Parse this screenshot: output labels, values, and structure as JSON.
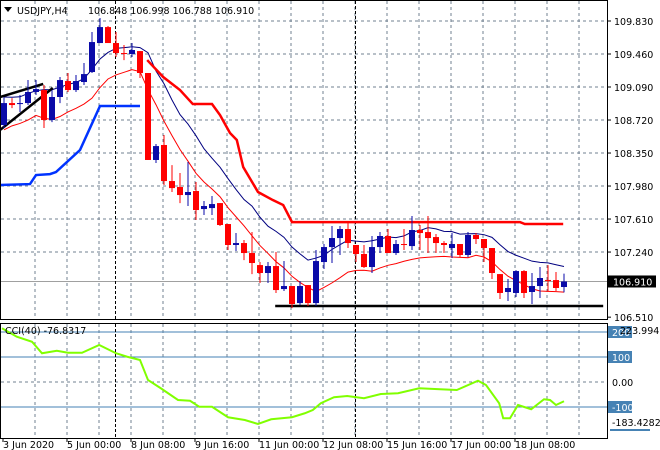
{
  "header": {
    "symbol": "USDJPY,H4",
    "ohlc": "106.848 106.998 106.788 106.910",
    "menu_icon": "triangle-down-icon"
  },
  "colors": {
    "bull": "#0a0aa8",
    "bear": "#ff0000",
    "ma_fast": "#ff0000",
    "ma_slow": "#000080",
    "trail_red": "#ff0000",
    "trail_blue": "#0033ff",
    "cci": "#80ff00",
    "grid": "#708090",
    "level": "#4682b4"
  },
  "chart_data": [
    {
      "type": "candlestick",
      "title": "USDJPY,H4",
      "ylim": [
        106.45,
        110.05
      ],
      "y_ticks": [
        "109.830",
        "109.460",
        "109.090",
        "108.720",
        "108.350",
        "107.980",
        "107.610",
        "107.240",
        "106.510"
      ],
      "current_price": "106.910",
      "x_tick_labels": [
        "3 Jun 2020",
        "5 Jun 00:00",
        "8 Jun 08:00",
        "9 Jun 16:00",
        "11 Jun 00:00",
        "12 Jun 08:00",
        "15 Jun 16:00",
        "17 Jun 00:00",
        "18 Jun 08:00"
      ],
      "x_tick_index": [
        0,
        8,
        16,
        24,
        32,
        40,
        48,
        56,
        64
      ],
      "candles_ohlc": [
        [
          108.664,
          108.978,
          108.63,
          108.91
        ],
        [
          108.91,
          108.966,
          108.854,
          108.888
        ],
        [
          108.899,
          109.0,
          108.81,
          108.91
        ],
        [
          108.91,
          109.168,
          108.888,
          109.034
        ],
        [
          109.034,
          109.168,
          109.0,
          109.067
        ],
        [
          109.056,
          109.112,
          108.63,
          108.72
        ],
        [
          108.72,
          109.056,
          108.697,
          108.978
        ],
        [
          108.978,
          109.202,
          108.91,
          109.168
        ],
        [
          109.157,
          109.247,
          109.034,
          109.056
        ],
        [
          109.056,
          109.224,
          109.034,
          109.157
        ],
        [
          109.146,
          109.359,
          109.112,
          109.235
        ],
        [
          109.258,
          109.706,
          109.247,
          109.594
        ],
        [
          109.583,
          109.863,
          109.583,
          109.762
        ],
        [
          109.762,
          109.774,
          109.583,
          109.583
        ],
        [
          109.583,
          109.706,
          109.426,
          109.471
        ],
        [
          109.471,
          109.561,
          109.392,
          109.46
        ],
        [
          109.46,
          109.583,
          109.426,
          109.505
        ],
        [
          109.493,
          109.493,
          109.191,
          109.247
        ],
        [
          109.247,
          109.247,
          108.272,
          108.272
        ],
        [
          108.272,
          108.451,
          108.238,
          108.428
        ],
        [
          108.44,
          108.552,
          107.991,
          108.036
        ],
        [
          108.036,
          108.215,
          107.913,
          107.957
        ],
        [
          107.969,
          108.126,
          107.789,
          107.879
        ],
        [
          107.879,
          108.249,
          107.756,
          107.913
        ],
        [
          107.924,
          108.025,
          107.599,
          107.711
        ],
        [
          107.722,
          107.812,
          107.655,
          107.756
        ],
        [
          107.733,
          107.868,
          107.655,
          107.778
        ],
        [
          107.789,
          107.789,
          107.532,
          107.543
        ],
        [
          107.554,
          107.554,
          107.263,
          107.319
        ],
        [
          107.319,
          107.453,
          107.251,
          107.341
        ],
        [
          107.341,
          107.375,
          107.15,
          107.229
        ],
        [
          107.229,
          107.464,
          106.993,
          107.117
        ],
        [
          107.094,
          107.128,
          106.893,
          107.005
        ],
        [
          107.005,
          107.128,
          106.893,
          107.083
        ],
        [
          107.083,
          107.24,
          106.781,
          106.814
        ],
        [
          106.825,
          107.139,
          106.803,
          106.859
        ],
        [
          106.859,
          106.859,
          106.612,
          106.657
        ],
        [
          106.668,
          106.915,
          106.646,
          106.859
        ],
        [
          106.87,
          106.87,
          106.635,
          106.668
        ],
        [
          106.668,
          107.263,
          106.635,
          107.139
        ],
        [
          107.128,
          107.33,
          107.05,
          107.296
        ],
        [
          107.296,
          107.532,
          107.117,
          107.397
        ],
        [
          107.397,
          107.532,
          107.207,
          107.498
        ],
        [
          107.498,
          107.576,
          107.285,
          107.341
        ],
        [
          107.319,
          107.319,
          107.128,
          107.218
        ],
        [
          107.218,
          107.319,
          107.061,
          107.072
        ],
        [
          107.072,
          107.42,
          107.005,
          107.296
        ],
        [
          107.296,
          107.464,
          107.229,
          107.42
        ],
        [
          107.42,
          107.498,
          107.229,
          107.229
        ],
        [
          107.229,
          107.375,
          107.207,
          107.33
        ],
        [
          107.33,
          107.498,
          107.263,
          107.319
        ],
        [
          107.307,
          107.644,
          107.263,
          107.487
        ],
        [
          107.487,
          107.543,
          107.263,
          107.453
        ],
        [
          107.464,
          107.644,
          107.229,
          107.397
        ],
        [
          107.408,
          107.442,
          107.229,
          107.341
        ],
        [
          107.341,
          107.363,
          107.229,
          107.319
        ],
        [
          107.285,
          107.453,
          107.173,
          107.33
        ],
        [
          107.33,
          107.33,
          107.184,
          107.207
        ],
        [
          107.207,
          107.464,
          107.184,
          107.431
        ],
        [
          107.431,
          107.453,
          107.33,
          107.386
        ],
        [
          107.386,
          107.386,
          107.128,
          107.285
        ],
        [
          107.285,
          107.285,
          106.938,
          107.005
        ],
        [
          106.993,
          106.993,
          106.714,
          106.781
        ],
        [
          106.792,
          106.938,
          106.691,
          106.837
        ],
        [
          106.781,
          107.038,
          106.736,
          107.027
        ],
        [
          107.027,
          107.038,
          106.725,
          106.781
        ],
        [
          106.792,
          107.005,
          106.657,
          106.859
        ],
        [
          106.859,
          107.072,
          106.725,
          106.949
        ],
        [
          106.927,
          107.094,
          106.803,
          106.915
        ],
        [
          106.926,
          107.016,
          106.803,
          106.837
        ],
        [
          106.848,
          106.998,
          106.788,
          106.91
        ]
      ],
      "trail_red": [
        [
          17.9,
          109.392
        ],
        [
          19.9,
          109.202
        ],
        [
          22.0,
          109.056
        ],
        [
          23.6,
          108.899
        ],
        [
          26.0,
          108.899
        ],
        [
          27.0,
          108.776
        ],
        [
          28.25,
          108.574
        ],
        [
          29.1,
          108.496
        ],
        [
          29.9,
          108.193
        ],
        [
          31.75,
          107.913
        ],
        [
          33.6,
          107.823
        ],
        [
          34.9,
          107.767
        ],
        [
          36.0,
          107.576
        ],
        [
          64.5,
          107.576
        ],
        [
          65.1,
          107.554
        ],
        [
          69.9,
          107.554
        ]
      ],
      "trail_blue": [
        [
          -0.5,
          107.991
        ],
        [
          3.25,
          108.002
        ],
        [
          4.0,
          108.103
        ],
        [
          5.75,
          108.114
        ],
        [
          6.5,
          108.137
        ],
        [
          9.5,
          108.384
        ],
        [
          12.0,
          108.877
        ],
        [
          17.0,
          108.877
        ]
      ],
      "trendlines": [
        [
          [
            -0.5,
            108.978
          ],
          [
            4.9,
            109.124
          ]
        ],
        [
          [
            -0.5,
            108.608
          ],
          [
            6.1,
            109.079
          ]
        ],
        [
          [
            33.9,
            106.635
          ],
          [
            74.9,
            106.635
          ]
        ]
      ],
      "vlines_index": [
        14,
        44
      ]
    },
    {
      "type": "line",
      "title": "CCI(40) -76.8317",
      "ylim": [
        -183.4282,
        223.9947
      ],
      "max_label": "223.9947",
      "min_label": "-183.4282",
      "levels": [
        {
          "value": 200,
          "label": "200"
        },
        {
          "value": 100,
          "label": "100"
        },
        {
          "value": 0,
          "label": "0.00"
        },
        {
          "value": -100,
          "label": "-100"
        }
      ],
      "points": [
        [
          -0.25,
          215
        ],
        [
          1.6,
          181
        ],
        [
          3.5,
          161
        ],
        [
          4.75,
          115
        ],
        [
          6.6,
          125
        ],
        [
          8,
          117
        ],
        [
          9.75,
          117
        ],
        [
          11.9,
          148
        ],
        [
          14,
          115
        ],
        [
          15.4,
          101
        ],
        [
          17,
          88
        ],
        [
          18,
          8
        ],
        [
          19.6,
          -25
        ],
        [
          21.75,
          -72
        ],
        [
          23.25,
          -75
        ],
        [
          24.4,
          -99
        ],
        [
          26,
          -99
        ],
        [
          28,
          -141
        ],
        [
          30.1,
          -152
        ],
        [
          31.75,
          -168
        ],
        [
          33.4,
          -149
        ],
        [
          36,
          -141
        ],
        [
          37.6,
          -125
        ],
        [
          38.6,
          -112
        ],
        [
          39.6,
          -85
        ],
        [
          41.25,
          -61
        ],
        [
          42.9,
          -56
        ],
        [
          45,
          -65
        ],
        [
          47.1,
          -48
        ],
        [
          49.25,
          -45
        ],
        [
          51.9,
          -25
        ],
        [
          54.5,
          -29
        ],
        [
          56.6,
          -32
        ],
        [
          59.25,
          5
        ],
        [
          60.25,
          -12
        ],
        [
          61.9,
          -85
        ],
        [
          62.4,
          -145
        ],
        [
          63.25,
          -145
        ],
        [
          64.25,
          -92
        ],
        [
          65.9,
          -109
        ],
        [
          67.5,
          -69
        ],
        [
          68.25,
          -72
        ],
        [
          69,
          -92
        ],
        [
          70,
          -77
        ]
      ]
    }
  ]
}
